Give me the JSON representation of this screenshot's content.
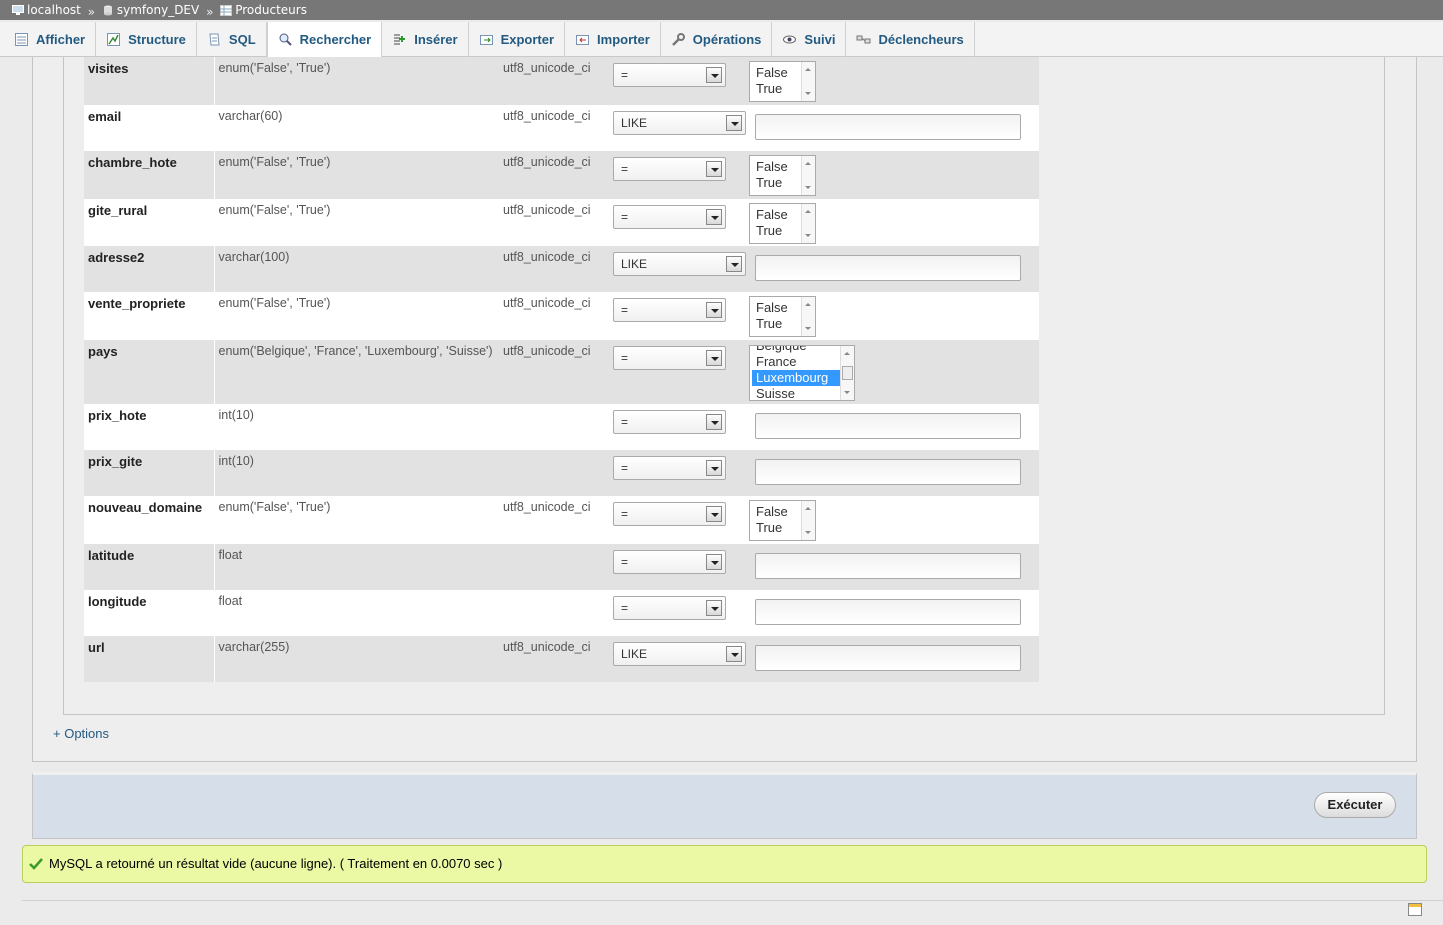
{
  "breadcrumb": {
    "server": "localhost",
    "database": "symfony_DEV",
    "table": "Producteurs",
    "separator": "»"
  },
  "tabs": [
    {
      "label": "Afficher",
      "icon": "browse-icon"
    },
    {
      "label": "Structure",
      "icon": "structure-icon"
    },
    {
      "label": "SQL",
      "icon": "sql-icon"
    },
    {
      "label": "Rechercher",
      "icon": "search-icon",
      "active": true
    },
    {
      "label": "Insérer",
      "icon": "insert-icon"
    },
    {
      "label": "Exporter",
      "icon": "export-icon"
    },
    {
      "label": "Importer",
      "icon": "import-icon"
    },
    {
      "label": "Opérations",
      "icon": "wrench-icon"
    },
    {
      "label": "Suivi",
      "icon": "eye-icon"
    },
    {
      "label": "Déclencheurs",
      "icon": "trigger-icon"
    }
  ],
  "rows": [
    {
      "name": "visites",
      "type": "enum('False', 'True')",
      "collation": "utf8_unicode_ci",
      "operator": "=",
      "value_kind": "list",
      "options": [
        "False",
        "True"
      ]
    },
    {
      "name": "email",
      "type": "varchar(60)",
      "collation": "utf8_unicode_ci",
      "operator": "LIKE",
      "value_kind": "text"
    },
    {
      "name": "chambre_hote",
      "type": "enum('False', 'True')",
      "collation": "utf8_unicode_ci",
      "operator": "=",
      "value_kind": "list",
      "options": [
        "False",
        "True"
      ]
    },
    {
      "name": "gite_rural",
      "type": "enum('False', 'True')",
      "collation": "utf8_unicode_ci",
      "operator": "=",
      "value_kind": "list",
      "options": [
        "False",
        "True"
      ]
    },
    {
      "name": "adresse2",
      "type": "varchar(100)",
      "collation": "utf8_unicode_ci",
      "operator": "LIKE",
      "value_kind": "text"
    },
    {
      "name": "vente_propriete",
      "type": "enum('False', 'True')",
      "collation": "utf8_unicode_ci",
      "operator": "=",
      "value_kind": "list",
      "options": [
        "False",
        "True"
      ]
    },
    {
      "name": "pays",
      "type": "enum('Belgique', 'France', 'Luxembourg', 'Suisse')",
      "collation": "utf8_unicode_ci",
      "operator": "=",
      "value_kind": "list-wide",
      "options": [
        "Belgique",
        "France",
        "Luxembourg",
        "Suisse"
      ],
      "selected": "Luxembourg"
    },
    {
      "name": "prix_hote",
      "type": "int(10)",
      "collation": "",
      "operator": "=",
      "value_kind": "text"
    },
    {
      "name": "prix_gite",
      "type": "int(10)",
      "collation": "",
      "operator": "=",
      "value_kind": "text"
    },
    {
      "name": "nouveau_domaine",
      "type": "enum('False', 'True')",
      "collation": "utf8_unicode_ci",
      "operator": "=",
      "value_kind": "list",
      "options": [
        "False",
        "True"
      ]
    },
    {
      "name": "latitude",
      "type": "float",
      "collation": "",
      "operator": "=",
      "value_kind": "text"
    },
    {
      "name": "longitude",
      "type": "float",
      "collation": "",
      "operator": "=",
      "value_kind": "text"
    },
    {
      "name": "url",
      "type": "varchar(255)",
      "collation": "utf8_unicode_ci",
      "operator": "LIKE",
      "value_kind": "text"
    }
  ],
  "options_link": "+ Options",
  "execute_label": "Exécuter",
  "status_message": "MySQL a retourné un résultat vide (aucune ligne). ( Traitement en 0.0070 sec )",
  "colors": {
    "tab_text": "#235a81",
    "success_bg": "#ebf8a4",
    "selected_option": "#3399ff"
  }
}
